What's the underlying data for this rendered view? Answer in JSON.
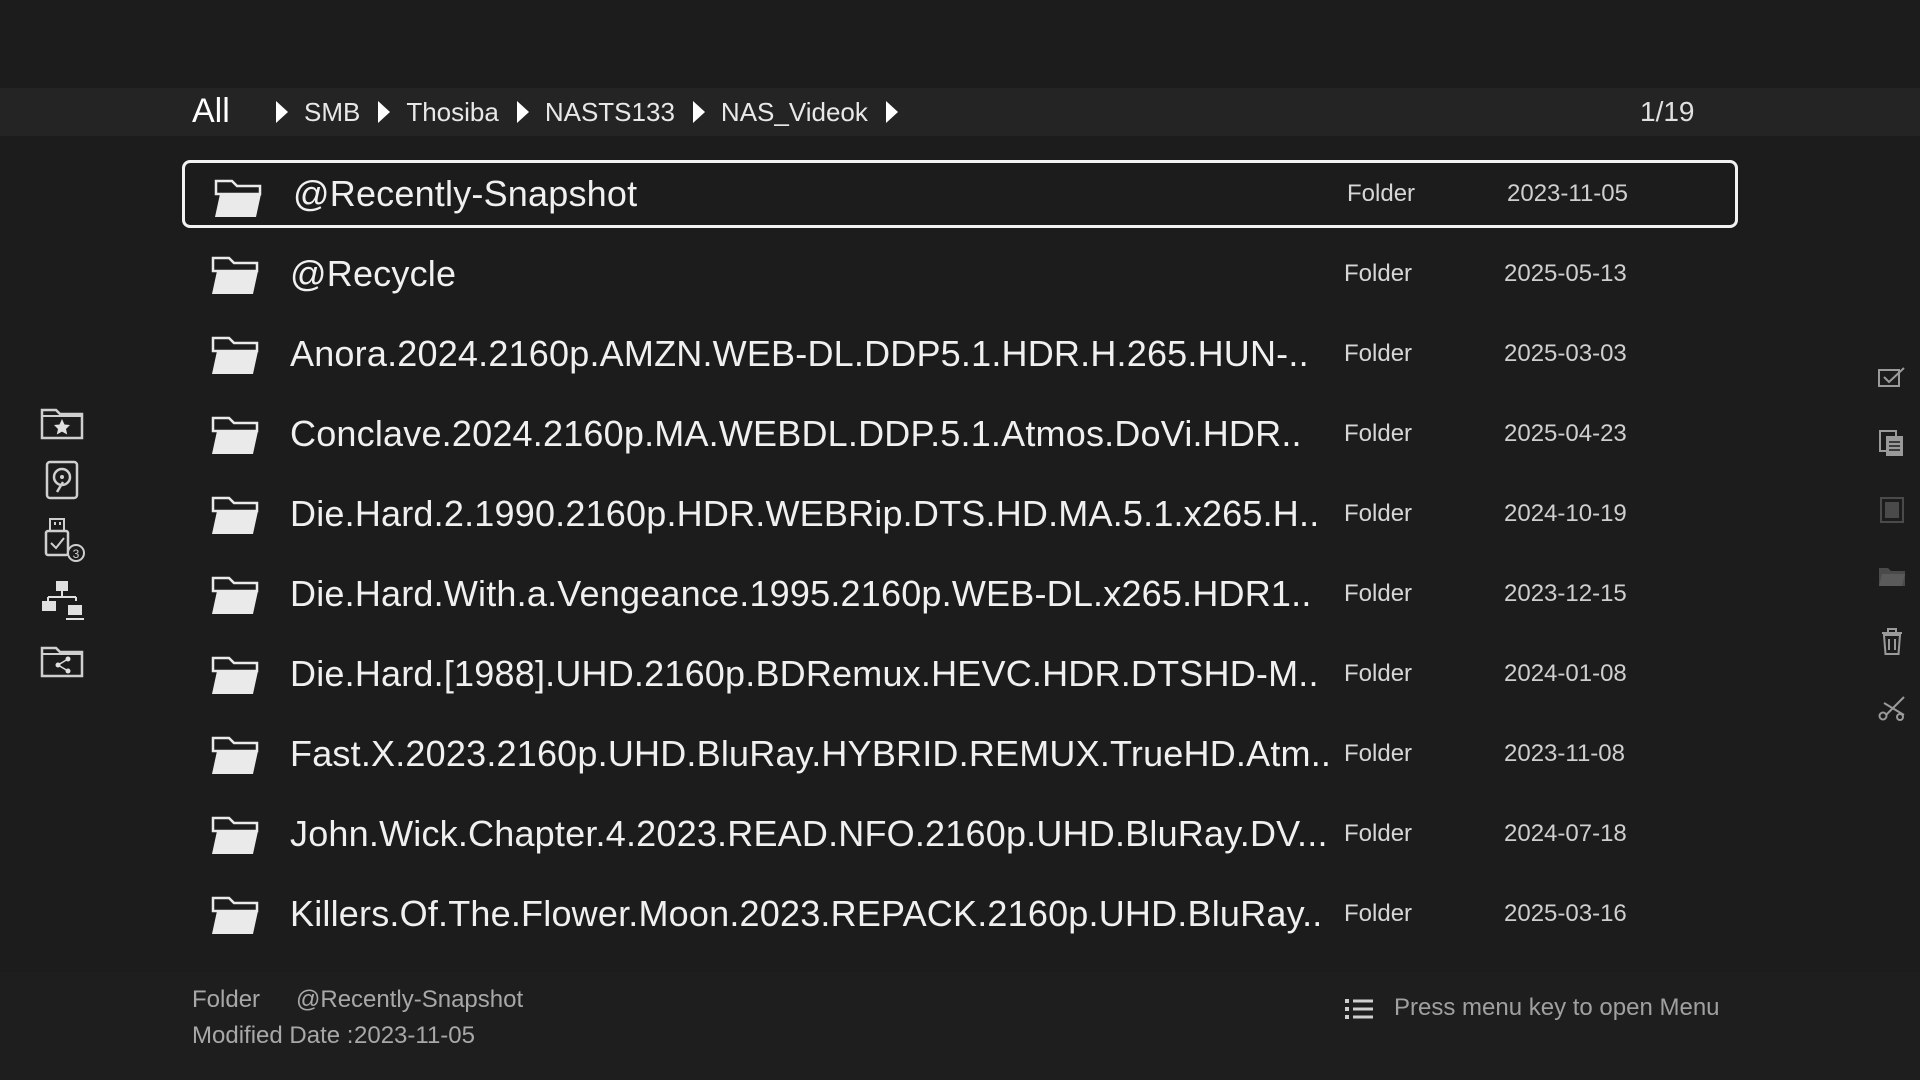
{
  "breadcrumb": {
    "root": "All",
    "items": [
      {
        "label": "SMB"
      },
      {
        "label": "Thosiba"
      },
      {
        "label": "NASTS133"
      },
      {
        "label": "NAS_Videok"
      }
    ],
    "page_indicator": "1/19"
  },
  "left_rail": [
    {
      "icon": "favorite-folder-icon"
    },
    {
      "icon": "local-storage-icon"
    },
    {
      "icon": "usb-device-icon",
      "badge": "3"
    },
    {
      "icon": "network-icon"
    },
    {
      "icon": "share-folder-icon"
    }
  ],
  "right_rail": [
    {
      "icon": "select-icon"
    },
    {
      "icon": "copy-icon"
    },
    {
      "icon": "paste-icon"
    },
    {
      "icon": "move-folder-icon"
    },
    {
      "icon": "delete-icon"
    },
    {
      "icon": "cut-icon"
    }
  ],
  "files": [
    {
      "name": "@Recently-Snapshot",
      "type": "Folder",
      "date": "2023-11-05",
      "selected": true
    },
    {
      "name": "@Recycle",
      "type": "Folder",
      "date": "2025-05-13"
    },
    {
      "name": "Anora.2024.2160p.AMZN.WEB-DL.DDP5.1.HDR.H.265.HUN-..",
      "type": "Folder",
      "date": "2025-03-03"
    },
    {
      "name": "Conclave.2024.2160p.MA.WEBDL.DDP.5.1.Atmos.DoVi.HDR..",
      "type": "Folder",
      "date": "2025-04-23"
    },
    {
      "name": "Die.Hard.2.1990.2160p.HDR.WEBRip.DTS.HD.MA.5.1.x265.H..",
      "type": "Folder",
      "date": "2024-10-19"
    },
    {
      "name": "Die.Hard.With.a.Vengeance.1995.2160p.WEB-DL.x265.HDR1..",
      "type": "Folder",
      "date": "2023-12-15"
    },
    {
      "name": "Die.Hard.[1988].UHD.2160p.BDRemux.HEVC.HDR.DTSHD-M..",
      "type": "Folder",
      "date": "2024-01-08"
    },
    {
      "name": "Fast.X.2023.2160p.UHD.BluRay.HYBRID.REMUX.TrueHD.Atm..",
      "type": "Folder",
      "date": "2023-11-08"
    },
    {
      "name": "John.Wick.Chapter.4.2023.READ.NFO.2160p.UHD.BluRay.DV...",
      "type": "Folder",
      "date": "2024-07-18"
    },
    {
      "name": "Killers.Of.The.Flower.Moon.2023.REPACK.2160p.UHD.BluRay..",
      "type": "Folder",
      "date": "2025-03-16"
    }
  ],
  "footer": {
    "type": "Folder",
    "name": "@Recently-Snapshot",
    "modified_label": "Modified Date :",
    "modified_value": "2023-11-05",
    "menu_hint": "Press menu key to open Menu"
  }
}
